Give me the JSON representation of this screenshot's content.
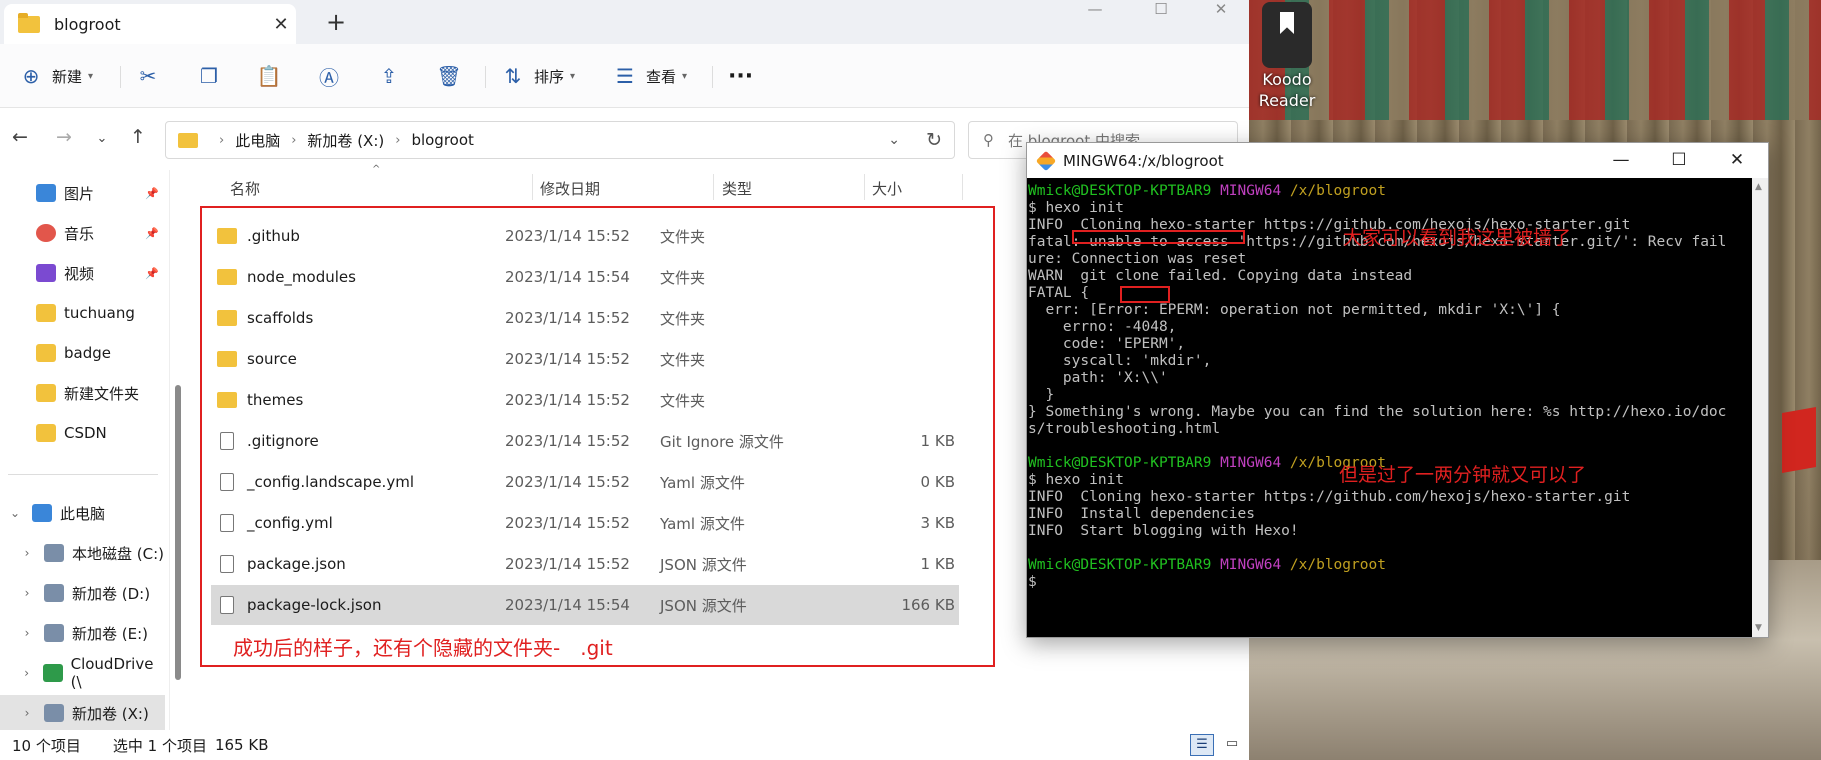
{
  "desktop": {
    "icon_label_1": "Koodo",
    "icon_label_2": "Reader"
  },
  "explorer": {
    "tab_title": "blogroot",
    "toolbar": {
      "new_label": "新建",
      "sort_label": "排序",
      "view_label": "查看",
      "more_label": "···"
    },
    "address": {
      "crumbs": [
        "此电脑",
        "新加卷 (X:)",
        "blogroot"
      ],
      "search_placeholder": "在 blogroot 中搜索"
    },
    "sidebar": {
      "quick": [
        {
          "label": "图片",
          "pinned": true
        },
        {
          "label": "音乐",
          "pinned": true
        },
        {
          "label": "视频",
          "pinned": true
        },
        {
          "label": "tuchuang",
          "pinned": false
        },
        {
          "label": "badge",
          "pinned": false
        },
        {
          "label": "新建文件夹",
          "pinned": false
        },
        {
          "label": "CSDN",
          "pinned": false
        }
      ],
      "this_pc": "此电脑",
      "drives": [
        "本地磁盘 (C:)",
        "新加卷 (D:)",
        "新加卷 (E:)",
        "CloudDrive (\\",
        "新加卷 (X:)"
      ]
    },
    "columns": {
      "name": "名称",
      "date": "修改日期",
      "type": "类型",
      "size": "大小"
    },
    "files": [
      {
        "name": ".github",
        "date": "2023/1/14 15:52",
        "type": "文件夹",
        "size": "",
        "kind": "folder"
      },
      {
        "name": "node_modules",
        "date": "2023/1/14 15:54",
        "type": "文件夹",
        "size": "",
        "kind": "folder"
      },
      {
        "name": "scaffolds",
        "date": "2023/1/14 15:52",
        "type": "文件夹",
        "size": "",
        "kind": "folder"
      },
      {
        "name": "source",
        "date": "2023/1/14 15:52",
        "type": "文件夹",
        "size": "",
        "kind": "folder"
      },
      {
        "name": "themes",
        "date": "2023/1/14 15:52",
        "type": "文件夹",
        "size": "",
        "kind": "folder"
      },
      {
        "name": ".gitignore",
        "date": "2023/1/14 15:52",
        "type": "Git Ignore 源文件",
        "size": "1 KB",
        "kind": "doc"
      },
      {
        "name": "_config.landscape.yml",
        "date": "2023/1/14 15:52",
        "type": "Yaml 源文件",
        "size": "0 KB",
        "kind": "doc"
      },
      {
        "name": "_config.yml",
        "date": "2023/1/14 15:52",
        "type": "Yaml 源文件",
        "size": "3 KB",
        "kind": "doc"
      },
      {
        "name": "package.json",
        "date": "2023/1/14 15:52",
        "type": "JSON 源文件",
        "size": "1 KB",
        "kind": "doc"
      },
      {
        "name": "package-lock.json",
        "date": "2023/1/14 15:54",
        "type": "JSON 源文件",
        "size": "166 KB",
        "kind": "doc",
        "selected": true
      }
    ],
    "annotation": "成功后的样子，还有个隐藏的文件夹-　.git",
    "status": {
      "count": "10 个项目",
      "selected": "选中 1 个项目",
      "size": "165 KB"
    }
  },
  "terminal": {
    "title": "MINGW64:/x/blogroot",
    "prompt_user": "Wmick@DESKTOP-KPTBAR9",
    "prompt_env": "MINGW64",
    "prompt_path": "/x/blogroot",
    "lines": [
      "$ hexo init",
      "INFO  Cloning hexo-starter https://github.com/hexojs/hexo-starter.git",
      "fatal: unable to access 'https://github.com/hexojs/hexo-starter.git/': Recv fail",
      "ure: Connection was reset",
      "WARN  git clone failed. Copying data instead",
      "FATAL {",
      "  err: [Error: EPERM: operation not permitted, mkdir 'X:\\'] {",
      "    errno: -4048,",
      "    code: 'EPERM',",
      "    syscall: 'mkdir',",
      "    path: 'X:\\\\'",
      "  }",
      "} Something's wrong. Maybe you can find the solution here: %s http://hexo.io/doc",
      "s/troubleshooting.html",
      "",
      "$ hexo init",
      "INFO  Cloning hexo-starter https://github.com/hexojs/hexo-starter.git",
      "INFO  Install dependencies",
      "INFO  Start blogging with Hexo!",
      "",
      "$"
    ],
    "annotation_blocked": "大家可以看到我这里被墙了",
    "annotation_ok": "但是过了一两分钟就又可以了"
  }
}
